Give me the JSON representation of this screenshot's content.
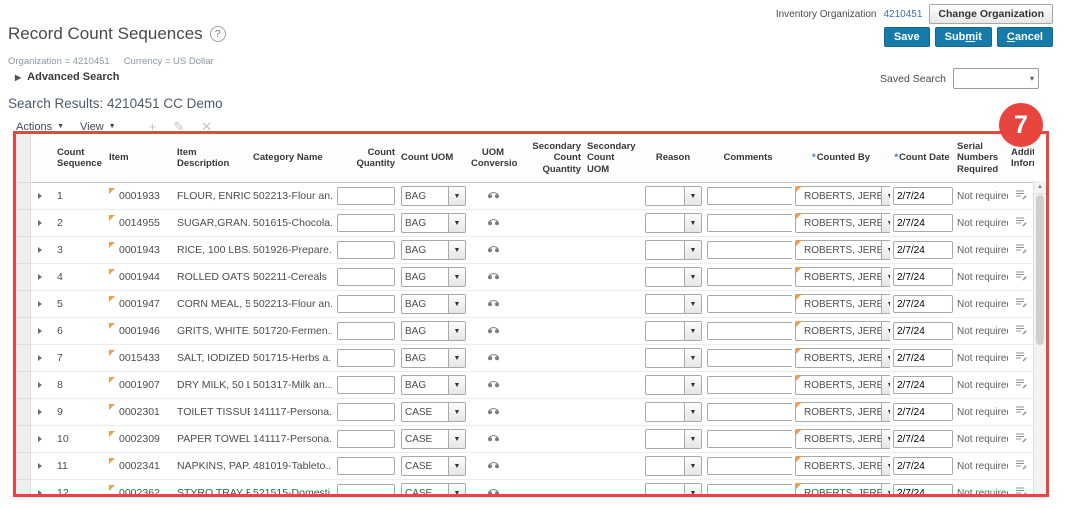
{
  "icons": {
    "help": "?",
    "menu_caret": "▼",
    "add": "+",
    "edit": "✎",
    "delete": "✕",
    "select_caret": "▾",
    "combo_caret": "▼",
    "scroll_up": "▲"
  },
  "top_bar": {
    "inventory_org_label": "Inventory Organization",
    "inventory_org_value": "4210451",
    "change_org_button": "Change Organization"
  },
  "buttons": {
    "save": "Save",
    "submit_pre": "Sub",
    "submit_key": "m",
    "submit_post": "it",
    "cancel_key": "C",
    "cancel_post": "ancel"
  },
  "header": {
    "title": "Record Count Sequences",
    "org_context": "Organization = 4210451",
    "currency_context": "Currency = US Dollar",
    "advanced_search": "Advanced Search",
    "saved_search_label": "Saved Search"
  },
  "results": {
    "title": "Search Results: 4210451 CC Demo",
    "actions": "Actions",
    "view": "View"
  },
  "annotation": {
    "number": "7",
    "color": "#e8453f"
  },
  "table": {
    "required_marker": "*",
    "headers": {
      "count_sequence": "Count Sequence",
      "item": "Item",
      "item_description": "Item Description",
      "category_name": "Category Name",
      "count_quantity": "Count Quantity",
      "count_uom": "Count UOM",
      "uom_conversions": "UOM Conversions",
      "secondary_count_quantity": "Secondary Count Quantity",
      "secondary_count_uom": "Secondary Count UOM",
      "reason": "Reason",
      "comments": "Comments",
      "counted_by": "Counted By",
      "count_date": "Count Date",
      "serial_numbers_required": "Serial Numbers Required",
      "additional_information": "Addit Inform"
    },
    "rows": [
      {
        "seq": "1",
        "item": "0001933",
        "desc": "FLOUR, ENRIC...",
        "cat": "502213-Flour an...",
        "uom": "BAG",
        "counted_by": "ROBERTS, JEREMY",
        "date": "2/7/24",
        "serial": "Not required"
      },
      {
        "seq": "2",
        "item": "0014955",
        "desc": "SUGAR,GRAN...",
        "cat": "501615-Chocola...",
        "uom": "BAG",
        "counted_by": "ROBERTS, JEREMY",
        "date": "2/7/24",
        "serial": "Not required"
      },
      {
        "seq": "3",
        "item": "0001943",
        "desc": "RICE, 100 LBS. ...",
        "cat": "501926-Prepare...",
        "uom": "BAG",
        "counted_by": "ROBERTS, JEREMY",
        "date": "2/7/24",
        "serial": "Not required"
      },
      {
        "seq": "4",
        "item": "0001944",
        "desc": "ROLLED OATS...",
        "cat": "502211-Cereals",
        "uom": "BAG",
        "counted_by": "ROBERTS, JEREMY",
        "date": "2/7/24",
        "serial": "Not required"
      },
      {
        "seq": "5",
        "item": "0001947",
        "desc": "CORN MEAL, 5...",
        "cat": "502213-Flour an...",
        "uom": "BAG",
        "counted_by": "ROBERTS, JEREMY",
        "date": "2/7/24",
        "serial": "Not required"
      },
      {
        "seq": "6",
        "item": "0001946",
        "desc": "GRITS, WHITE,...",
        "cat": "501720-Fermen...",
        "uom": "BAG",
        "counted_by": "ROBERTS, JEREMY",
        "date": "2/7/24",
        "serial": "Not required"
      },
      {
        "seq": "7",
        "item": "0015433",
        "desc": "SALT, IODIZED...",
        "cat": "501715-Herbs a...",
        "uom": "BAG",
        "counted_by": "ROBERTS, JEREMY",
        "date": "2/7/24",
        "serial": "Not required"
      },
      {
        "seq": "8",
        "item": "0001907",
        "desc": "DRY MILK, 50 L...",
        "cat": "501317-Milk an...",
        "uom": "BAG",
        "counted_by": "ROBERTS, JEREMY",
        "date": "2/7/24",
        "serial": "Not required"
      },
      {
        "seq": "9",
        "item": "0002301",
        "desc": "TOILET TISSUE...",
        "cat": "141117-Persona...",
        "uom": "CASE",
        "counted_by": "ROBERTS, JEREMY",
        "date": "2/7/24",
        "serial": "Not required"
      },
      {
        "seq": "10",
        "item": "0002309",
        "desc": "PAPER TOWEL...",
        "cat": "141117-Persona...",
        "uom": "CASE",
        "counted_by": "ROBERTS, JEREMY",
        "date": "2/7/24",
        "serial": "Not required"
      },
      {
        "seq": "11",
        "item": "0002341",
        "desc": "NAPKINS, PAP...",
        "cat": "481019-Tableto...",
        "uom": "CASE",
        "counted_by": "ROBERTS, JEREMY",
        "date": "2/7/24",
        "serial": "Not required"
      },
      {
        "seq": "12",
        "item": "0002362",
        "desc": "STYRO TRAY B...",
        "cat": "521515-Domesti...",
        "uom": "CASE",
        "counted_by": "ROBERTS, JEREMY",
        "date": "2/7/24",
        "serial": "Not required"
      }
    ]
  }
}
